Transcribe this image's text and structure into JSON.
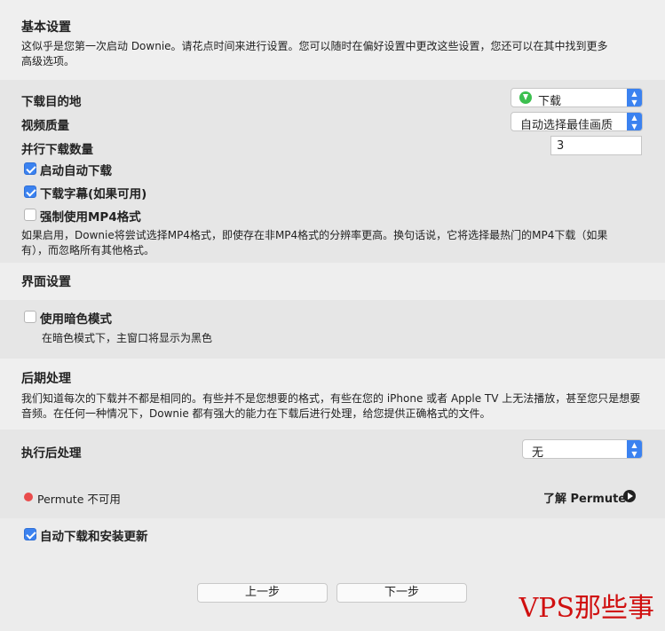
{
  "basic": {
    "title": "基本设置",
    "desc_line1": "这似乎是您第一次启动 Downie。请花点时间来进行设置。您可以随时在偏好设置中更改这些设置，您还可以在其中找到更多",
    "desc_line2": "高级选项。"
  },
  "download": {
    "dest_label": "下载目的地",
    "dest_value": "下载",
    "quality_label": "视频质量",
    "quality_value": "自动选择最佳画质",
    "parallel_label": "并行下载数量",
    "parallel_value": "3",
    "auto_download_label": "启动自动下载",
    "auto_download_checked": true,
    "subtitles_label": "下载字幕(如果可用)",
    "subtitles_checked": true,
    "mp4_label": "强制使用MP4格式",
    "mp4_checked": false,
    "mp4_desc_line1": "如果启用，Downie将尝试选择MP4格式，即使存在非MP4格式的分辨率更高。换句话说，它将选择最热门的MP4下载（如果",
    "mp4_desc_line2": "有），而忽略所有其他格式。"
  },
  "ui": {
    "title": "界面设置",
    "dark_label": "使用暗色模式",
    "dark_checked": false,
    "dark_desc": "在暗色模式下，主窗口将显示为黑色"
  },
  "post": {
    "title": "后期处理",
    "desc_line1": "我们知道每次的下载并不都是相同的。有些并不是您想要的格式，有些在您的 iPhone 或者 Apple TV 上无法播放，甚至您只是想要",
    "desc_line2": "音频。在任何一种情况下，Downie 都有强大的能力在下载后进行处理，给您提供正确格式的文件。",
    "exec_label": "执行后处理",
    "exec_value": "无",
    "permute_status": "Permute 不可用",
    "permute_link": "了解 Permute"
  },
  "update": {
    "label": "自动下载和安装更新",
    "checked": true
  },
  "footer": {
    "prev": "上一步",
    "next": "下一步"
  },
  "watermark": "VPS那些事",
  "colors": {
    "accent": "#3b82f0",
    "status_red": "#e94b4b",
    "download_icon": "#3cbf4f",
    "watermark": "#d01010"
  }
}
